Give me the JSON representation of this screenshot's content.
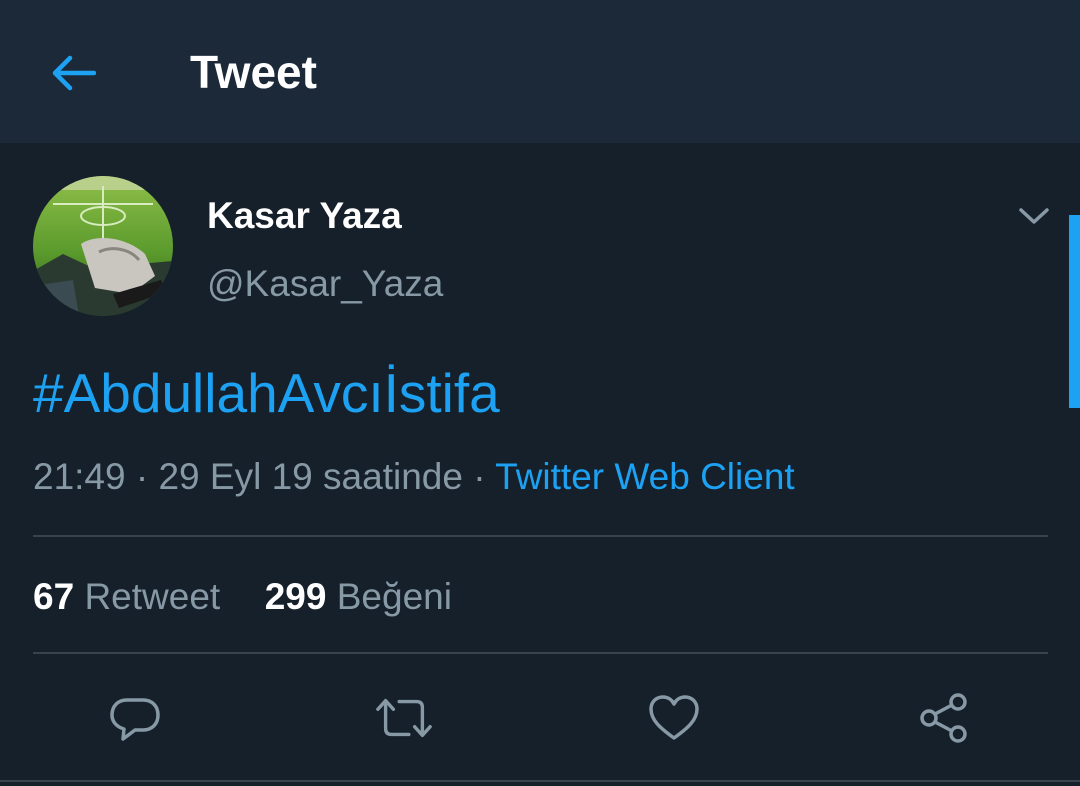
{
  "header": {
    "title": "Tweet",
    "back_icon": "arrow-left-icon"
  },
  "colors": {
    "background": "#15202b",
    "header_background": "#1c2938",
    "accent": "#1da1f2",
    "muted_text": "#8899a6",
    "divider": "#38444d"
  },
  "tweet": {
    "author": {
      "display_name": "Kasar Yaza",
      "handle": "@Kasar_Yaza",
      "avatar": "football-stadium-photo"
    },
    "text": "#AbdullahAvcıİstifa",
    "time": "21:49",
    "separator": "·",
    "date": "29 Eyl 19 saatinde",
    "source": "Twitter Web Client",
    "caret_icon": "chevron-down-icon"
  },
  "stats": {
    "retweets_count": "67",
    "retweets_label": "Retweet",
    "likes_count": "299",
    "likes_label": "Beğeni"
  },
  "actions": [
    {
      "icon": "reply-icon"
    },
    {
      "icon": "retweet-icon"
    },
    {
      "icon": "heart-icon"
    },
    {
      "icon": "share-icon"
    }
  ]
}
